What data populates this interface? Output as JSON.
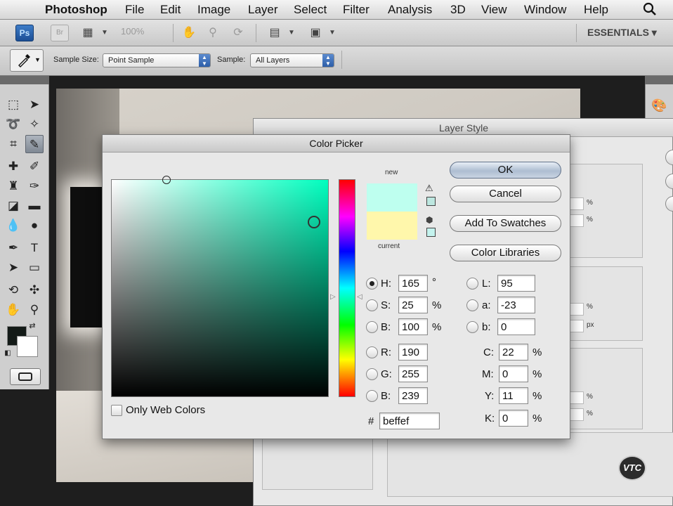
{
  "menubar": {
    "app": "Photoshop",
    "items": [
      "File",
      "Edit",
      "Image",
      "Layer",
      "Select",
      "Filter",
      "Analysis",
      "3D",
      "View",
      "Window",
      "Help"
    ]
  },
  "appbar": {
    "ps_logo": "Ps",
    "br_logo": "Br",
    "zoom": "100%",
    "workspace": "ESSENTIALS ▾"
  },
  "options": {
    "sample_size_label": "Sample Size:",
    "sample_size_value": "Point Sample",
    "sample_label": "Sample:",
    "sample_value": "All Layers"
  },
  "layer_style": {
    "title": "Layer Style",
    "units": [
      "%",
      "%",
      "%",
      "px",
      "%",
      "%"
    ]
  },
  "color_picker": {
    "title": "Color Picker",
    "new_label": "new",
    "current_label": "current",
    "new_color": "#beffef",
    "current_color": "#fff7ab",
    "buttons": {
      "ok": "OK",
      "cancel": "Cancel",
      "add_swatches": "Add To Swatches",
      "libraries": "Color Libraries"
    },
    "hsb": {
      "h_label": "H:",
      "h": "165",
      "h_unit": "°",
      "s_label": "S:",
      "s": "25",
      "s_unit": "%",
      "b_label": "B:",
      "b": "100",
      "b_unit": "%"
    },
    "rgb": {
      "r_label": "R:",
      "r": "190",
      "g_label": "G:",
      "g": "255",
      "b_label": "B:",
      "b": "239"
    },
    "lab": {
      "l_label": "L:",
      "l": "95",
      "a_label": "a:",
      "a": "-23",
      "b_label": "b:",
      "b": "0"
    },
    "cmyk": {
      "c_label": "C:",
      "c": "22",
      "m_label": "M:",
      "m": "0",
      "y_label": "Y:",
      "y": "11",
      "k_label": "K:",
      "k": "0",
      "unit": "%"
    },
    "hex_label": "#",
    "hex": "beffef",
    "web_colors_label": "Only Web Colors"
  },
  "watermark": "VTC"
}
